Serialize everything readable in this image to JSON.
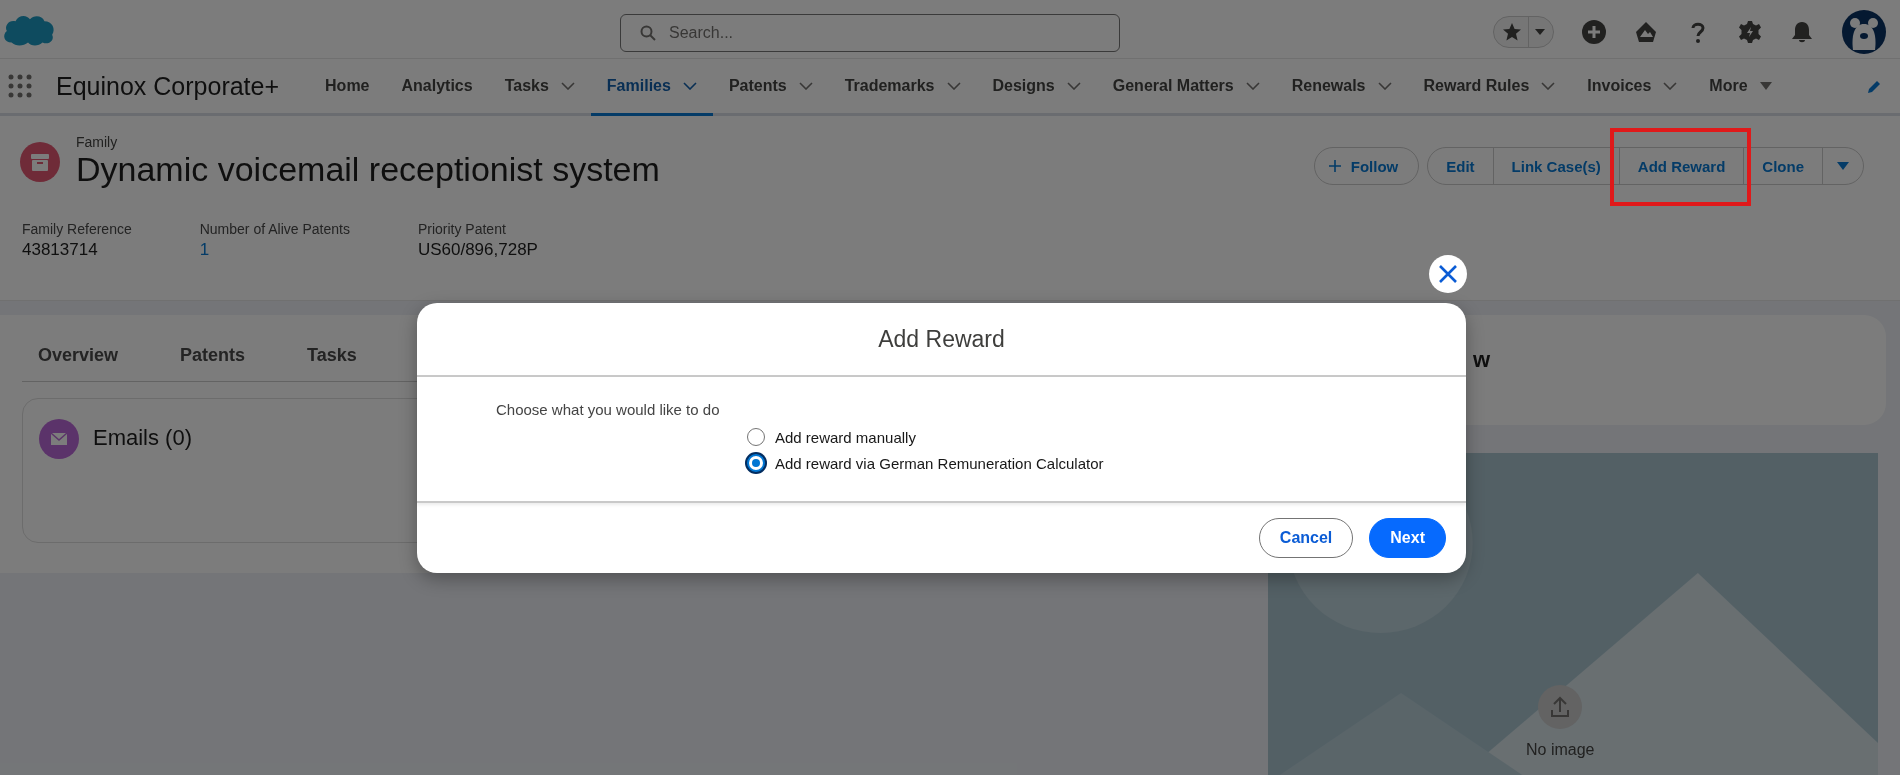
{
  "app_header": {
    "search": {
      "placeholder": "Search..."
    }
  },
  "nav": {
    "app_name": "Equinox Corporate+",
    "items": [
      {
        "label": "Home",
        "has_menu": false,
        "selected": false
      },
      {
        "label": "Analytics",
        "has_menu": false,
        "selected": false
      },
      {
        "label": "Tasks",
        "has_menu": true,
        "selected": false
      },
      {
        "label": "Families",
        "has_menu": true,
        "selected": true
      },
      {
        "label": "Patents",
        "has_menu": true,
        "selected": false
      },
      {
        "label": "Trademarks",
        "has_menu": true,
        "selected": false
      },
      {
        "label": "Designs",
        "has_menu": true,
        "selected": false
      },
      {
        "label": "General Matters",
        "has_menu": true,
        "selected": false
      },
      {
        "label": "Renewals",
        "has_menu": true,
        "selected": false
      },
      {
        "label": "Reward Rules",
        "has_menu": true,
        "selected": false
      },
      {
        "label": "Invoices",
        "has_menu": true,
        "selected": false
      }
    ],
    "more": "More"
  },
  "record": {
    "object_label": "Family",
    "title": "Dynamic voicemail receptionist system",
    "follow": "Follow",
    "buttons": [
      {
        "label": "Edit",
        "highlighted": false
      },
      {
        "label": "Link Case(s)",
        "highlighted": false
      },
      {
        "label": "Add Reward",
        "highlighted": true
      },
      {
        "label": "Clone",
        "highlighted": false
      }
    ],
    "fields": [
      {
        "label": "Family Reference",
        "value": "43813714",
        "link": false
      },
      {
        "label": "Number of Alive Patents",
        "value": "1",
        "link": true
      },
      {
        "label": "Priority Patent",
        "value": "US60/896,728P",
        "link": false
      }
    ]
  },
  "tabs": [
    {
      "label": "Overview",
      "selected": false
    },
    {
      "label": "Patents",
      "selected": false
    },
    {
      "label": "Tasks",
      "selected": false
    }
  ],
  "emails_card": {
    "title": "Emails (0)"
  },
  "side_card": {
    "title": "w"
  },
  "image_panel": {
    "caption": "No image"
  },
  "modal": {
    "title": "Add Reward",
    "prompt": "Choose what you would like to do",
    "options": [
      {
        "label": "Add reward manually",
        "selected": false
      },
      {
        "label": "Add reward via German Remuneration Calculator",
        "selected": true
      }
    ],
    "buttons": [
      {
        "label": "Cancel",
        "kind": "neutral"
      },
      {
        "label": "Next",
        "kind": "brand"
      }
    ]
  }
}
